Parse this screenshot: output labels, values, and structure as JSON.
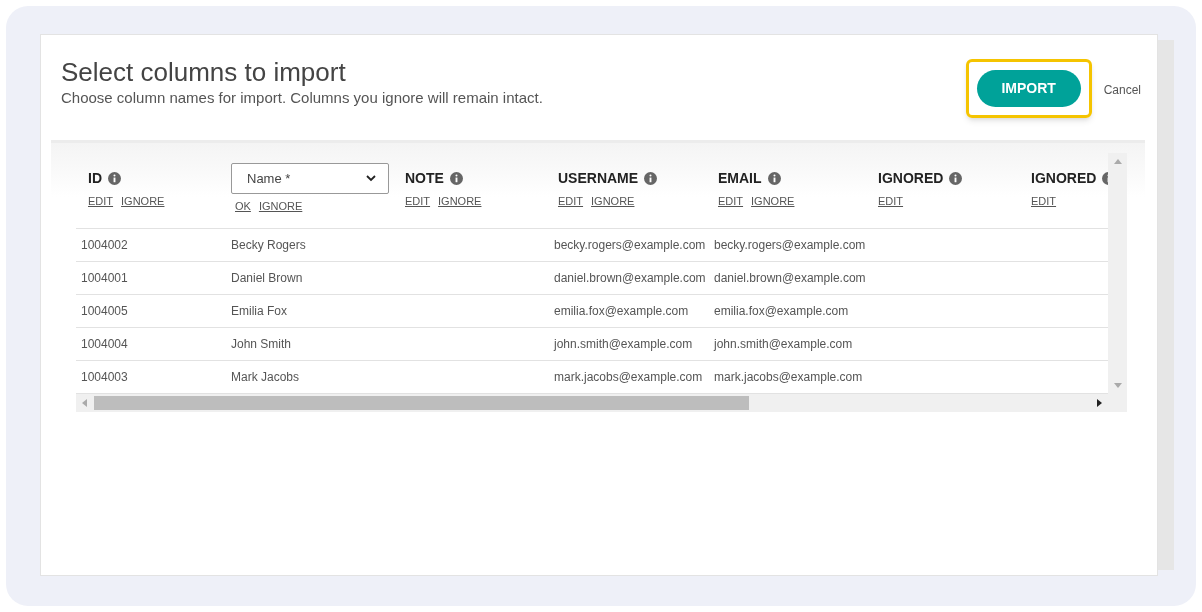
{
  "dialog": {
    "title": "Select columns to import",
    "subtitle": "Choose column names for import. Columns you ignore will remain intact.",
    "import_button": "IMPORT",
    "cancel_link": "Cancel"
  },
  "table": {
    "columns": [
      {
        "kind": "header",
        "label": "ID",
        "actions": [
          "EDIT",
          "IGNORE"
        ]
      },
      {
        "kind": "select",
        "value": "Name *",
        "actions": [
          "OK",
          "IGNORE"
        ]
      },
      {
        "kind": "header",
        "label": "NOTE",
        "actions": [
          "EDIT",
          "IGNORE"
        ]
      },
      {
        "kind": "header",
        "label": "USERNAME",
        "actions": [
          "EDIT",
          "IGNORE"
        ]
      },
      {
        "kind": "header",
        "label": "EMAIL",
        "actions": [
          "EDIT",
          "IGNORE"
        ]
      },
      {
        "kind": "header",
        "label": "IGNORED",
        "actions": [
          "EDIT"
        ]
      },
      {
        "kind": "header",
        "label": "IGNORED",
        "actions": [
          "EDIT"
        ]
      }
    ],
    "rows": [
      {
        "id": "1004002",
        "name": "Becky Rogers",
        "username": "becky.rogers@example.com",
        "email": "becky.rogers@example.com"
      },
      {
        "id": "1004001",
        "name": "Daniel Brown",
        "username": "daniel.brown@example.com",
        "email": "daniel.brown@example.com"
      },
      {
        "id": "1004005",
        "name": "Emilia Fox",
        "username": "emilia.fox@example.com",
        "email": "emilia.fox@example.com"
      },
      {
        "id": "1004004",
        "name": "John Smith",
        "username": "john.smith@example.com",
        "email": "john.smith@example.com"
      },
      {
        "id": "1004003",
        "name": "Mark Jacobs",
        "username": "mark.jacobs@example.com",
        "email": "mark.jacobs@example.com"
      }
    ]
  }
}
